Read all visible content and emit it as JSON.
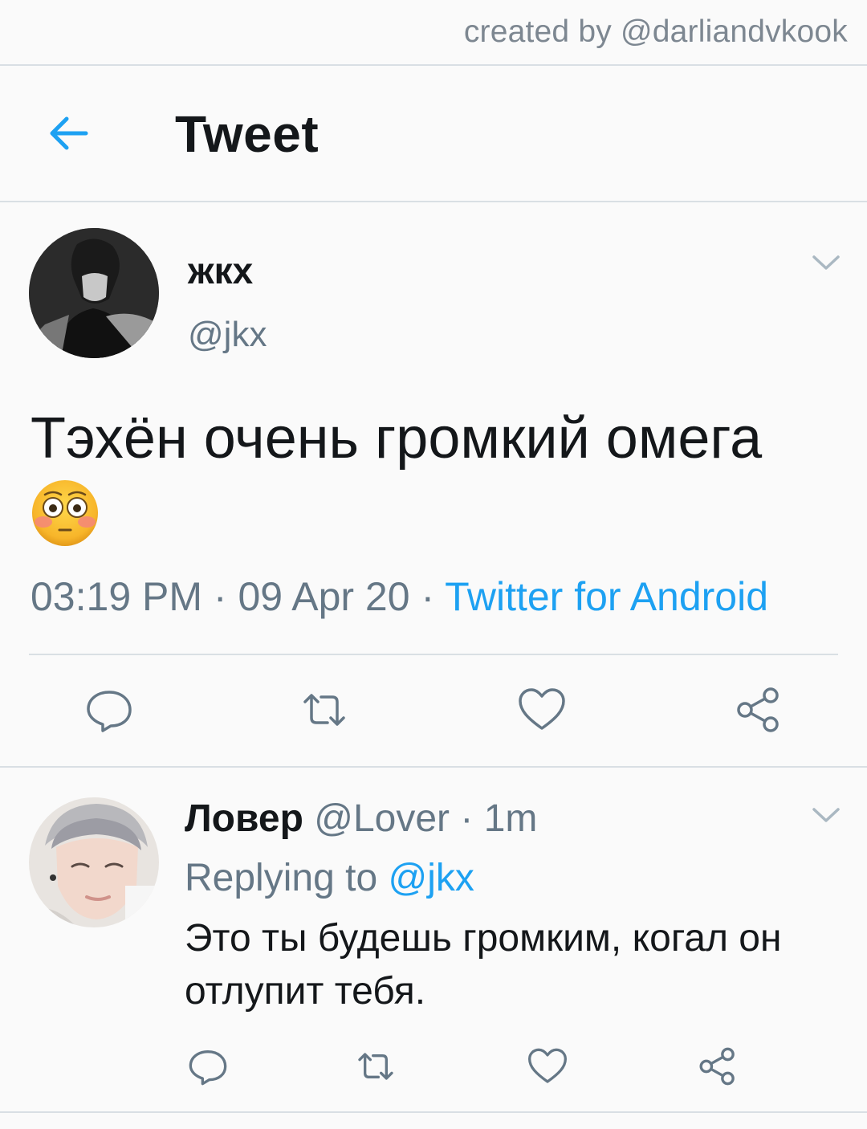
{
  "credit": "created by @darliandvkook",
  "header": {
    "title": "Tweet"
  },
  "tweet": {
    "display_name": "жкх",
    "handle": "@jkx",
    "text": "Тэхён очень громкий омега",
    "emoji": "flushed-face",
    "time": "03:19 PM",
    "date": "09 Apr 20",
    "source": "Twitter for Android"
  },
  "reply": {
    "display_name": "Ловер",
    "handle": "@Lover",
    "time": "1m",
    "replying_label": "Replying to",
    "replying_to": "@jkx",
    "text": "Это ты будешь громким, когал он отлупит тебя."
  },
  "colors": {
    "accent": "#1da1f2",
    "muted": "#657786",
    "divider": "#d9dfe4",
    "background": "#fafafa"
  },
  "icons": [
    "back-arrow-icon",
    "chevron-down-icon",
    "reply-icon",
    "retweet-icon",
    "like-icon",
    "share-icon"
  ]
}
